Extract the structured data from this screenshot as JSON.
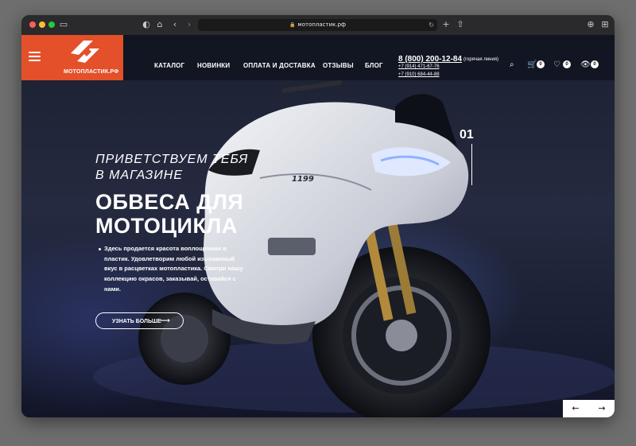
{
  "browser": {
    "url": "мотопластик.рф"
  },
  "header": {
    "logo_text": "МОТОПЛАСТИК.РФ",
    "nav": [
      "КАТАЛОГ",
      "НОВИНКИ",
      "ОПЛАТА И ДОСТАВКА",
      "ОТЗЫВЫ",
      "БЛОГ"
    ],
    "phone_main": "8 (800) 200-12-84",
    "phone_note": "(горячая линия)",
    "phone_2": "+7 (914) 471-67-76",
    "phone_3": "+7 (910) 684-44-88",
    "cart_count": "0",
    "wishlist_count": "0",
    "viewed_count": "0"
  },
  "hero": {
    "greeting_line1": "ПРИВЕТСТВУЕМ ТЕБЯ",
    "greeting_line2": "В МАГАЗИНЕ",
    "title_line1": "ОБВЕСА ДЛЯ",
    "title_line2": "МОТОЦИКЛА",
    "description": "Здесь продается красота воплощенная в пластик. Удовлетворим любой изысканный вкус в расцветках мотопластика. Смотри нашу коллекцию окрасов, заказывай, оставайся с нами.",
    "cta_label": "УЗНАТЬ БОЛЬШЕ",
    "slide_number": "01",
    "bike_model": "1199"
  },
  "colors": {
    "brand": "#e3502a",
    "header_bg": "#0a0c16",
    "text": "#ffffff"
  }
}
